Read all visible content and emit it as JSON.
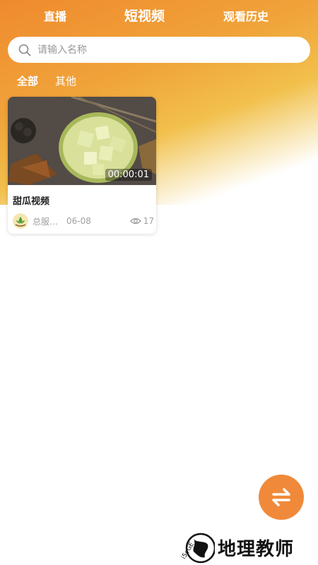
{
  "nav": {
    "tabs": [
      {
        "label": "直播"
      },
      {
        "label": "短视频"
      },
      {
        "label": "观看历史"
      }
    ],
    "active_index": 1
  },
  "search": {
    "placeholder": "请输入名称",
    "value": ""
  },
  "categories": [
    {
      "label": "全部"
    },
    {
      "label": "其他"
    }
  ],
  "videos": [
    {
      "title": "甜瓜视频",
      "duration": "00:00:01",
      "author": "总服…",
      "date": "06-08",
      "views": "17"
    }
  ],
  "watermark": {
    "text": "地理教师",
    "logo_text": "i 5 c G E"
  },
  "colors": {
    "accent": "#f08a3a",
    "gradient_start": "#ef8a2e",
    "gradient_mid": "#f2c04c"
  },
  "icons": {
    "search": "search-icon",
    "views": "eye-icon",
    "fab": "swap-arrows-icon"
  }
}
